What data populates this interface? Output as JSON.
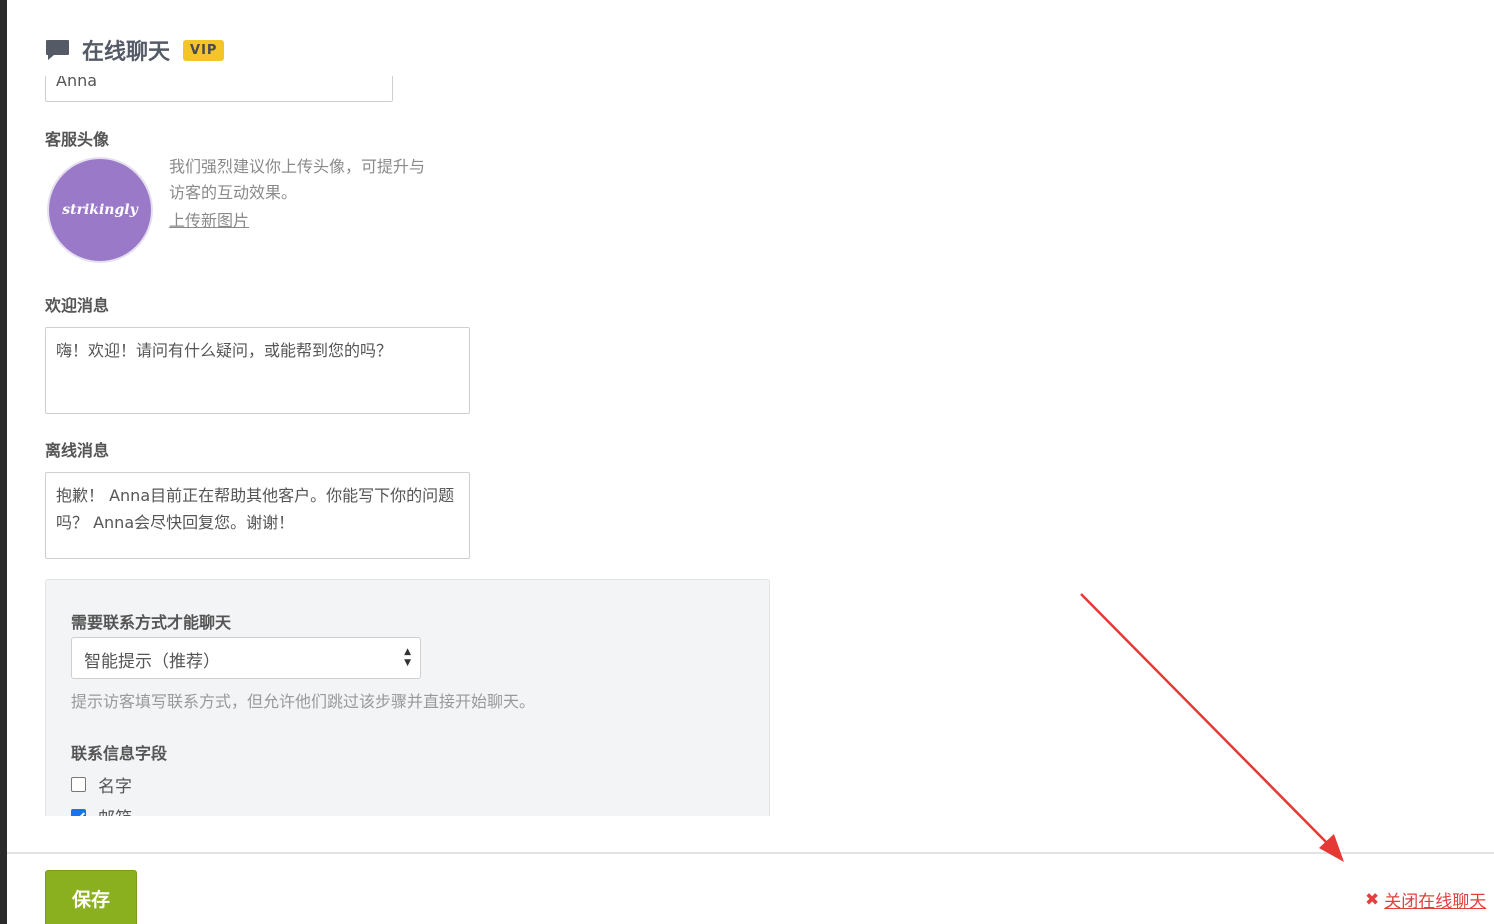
{
  "header": {
    "title": "在线聊天",
    "badge": "VIP",
    "icon": "chat-bubble-icon"
  },
  "form": {
    "agent_name_value": "Anna",
    "avatar_label": "客服头像",
    "avatar_brand": "strikingly",
    "avatar_hint": "我们强烈建议你上传头像，可提升与访客的互动效果。",
    "upload_link": "上传新图片",
    "welcome_label": "欢迎消息",
    "welcome_value": "嗨！欢迎！请问有什么疑问，或能帮到您的吗？",
    "offline_label": "离线消息",
    "offline_value": "抱歉！ Anna目前正在帮助其他客户。你能写下你的问题吗？ Anna会尽快回复您。谢谢！"
  },
  "contact": {
    "require_label": "需要联系方式才能聊天",
    "select_value": "智能提示（推荐）",
    "help_text": "提示访客填写联系方式，但允许他们跳过该步骤并直接开始聊天。",
    "fields_label": "联系信息字段",
    "fields": [
      {
        "label": "名字",
        "checked": false
      },
      {
        "label": "邮箱",
        "checked": true
      }
    ]
  },
  "footer": {
    "save_label": "保存",
    "close_label": "关闭在线聊天"
  },
  "colors": {
    "save": "#8ab01f",
    "vip": "#f4c528",
    "close": "#e04040",
    "arrow": "#e53935",
    "avatar": "#9b79c9"
  }
}
